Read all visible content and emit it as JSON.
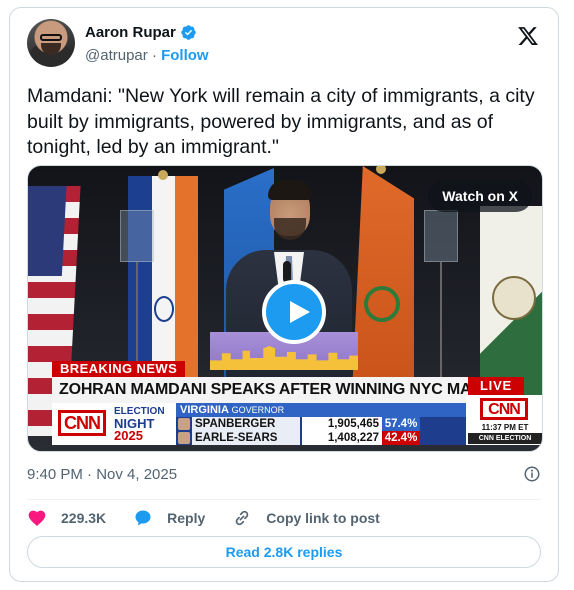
{
  "author": {
    "name": "Aaron Rupar",
    "handle": "@atrupar",
    "separator": "·",
    "follow_label": "Follow"
  },
  "tweet": {
    "text": "Mamdani: \"New York will remain a city of immigrants, a city built by immigrants, powered by immigrants, and as of tonight, led by an immigrant.\""
  },
  "media": {
    "watch_label": "Watch on X",
    "breaking": "BREAKING NEWS",
    "headline": "ZOHRAN MAMDANI SPEAKS AFTER WINNING NYC MAYOR'S RACE",
    "live": "LIVE",
    "cnn": "CNN",
    "election_l1": "ELECTION",
    "election_l2": "NIGHT",
    "election_l3": "2025",
    "race_state": "VIRGINIA",
    "race_office": "GOVERNOR",
    "candidates": [
      {
        "name": "SPANBERGER",
        "votes": "1,905,465",
        "pct": "57.4%",
        "color": "#2f63c4"
      },
      {
        "name": "EARLE-SEARS",
        "votes": "1,408,227",
        "pct": "42.4%",
        "color": "#cc0000"
      }
    ],
    "time": "11:37 PM ET",
    "network_tag": "CNN ELECTION"
  },
  "footer": {
    "timestamp": "9:40 PM · Nov 4, 2025",
    "likes": "229.3K",
    "reply_label": "Reply",
    "copy_label": "Copy link to post",
    "read_replies": "Read 2.8K replies"
  },
  "colors": {
    "accent": "#1d9bf0",
    "like": "#f91880",
    "muted": "#536471"
  }
}
